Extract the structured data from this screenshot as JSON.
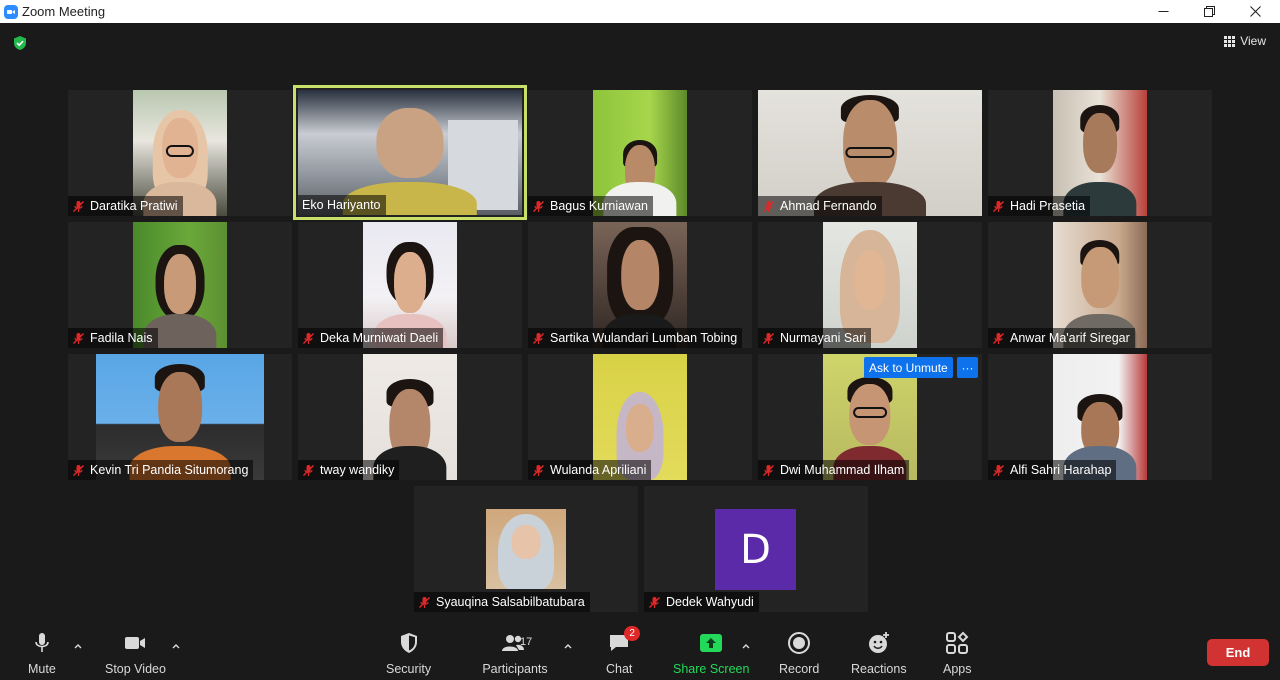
{
  "window": {
    "title": "Zoom Meeting"
  },
  "header": {
    "view_label": "View"
  },
  "participants_tiles": [
    {
      "name": "Daratika Pratiwi"
    },
    {
      "name": "Eko Hariyanto"
    },
    {
      "name": "Bagus Kurniawan"
    },
    {
      "name": "Ahmad Fernando"
    },
    {
      "name": "Hadi Prasetia"
    },
    {
      "name": "Fadila Nais"
    },
    {
      "name": "Deka Murniwati Daeli"
    },
    {
      "name": "Sartika Wulandari Lumban Tobing"
    },
    {
      "name": "Nurmayani Sari"
    },
    {
      "name": "Anwar Ma'arif Siregar"
    },
    {
      "name": "Kevin Tri Pandia Situmorang"
    },
    {
      "name": "tway wandiky"
    },
    {
      "name": "Wulanda Apriliani"
    },
    {
      "name": "Dwi Muhammad Ilham"
    },
    {
      "name": "Alfi Sahri Harahap"
    },
    {
      "name": "Syauqina Salsabilbatubara"
    },
    {
      "name": "Dedek Wahyudi",
      "avatar_letter": "D"
    }
  ],
  "overlay": {
    "ask_to_unmute": "Ask to Unmute",
    "more": "···"
  },
  "toolbar": {
    "mute": "Mute",
    "stop_video": "Stop Video",
    "security": "Security",
    "participants": "Participants",
    "participants_count": "17",
    "chat": "Chat",
    "chat_badge": "2",
    "share_screen": "Share Screen",
    "record": "Record",
    "reactions": "Reactions",
    "apps": "Apps",
    "end": "End"
  },
  "colors": {
    "active_speaker_border": "#c8e06a",
    "share_screen_green": "#23d959",
    "end_red": "#d13232",
    "unmute_blue": "#0e72ed",
    "avatar_purple": "#5b2aa8"
  }
}
